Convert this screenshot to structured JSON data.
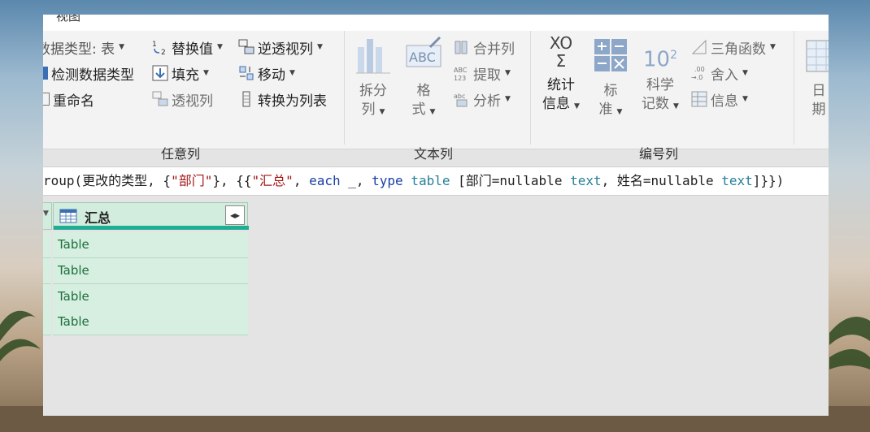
{
  "ribbon": {
    "tab_label": "视图",
    "groups": {
      "any_column": {
        "label": "任意列",
        "data_type": "数据类型: 表",
        "detect_type": "检测数据类型",
        "rename": "重命名",
        "replace_values": "替换值",
        "fill": "填充",
        "pivot": "透视列",
        "unpivot": "逆透视列",
        "move": "移动",
        "to_list": "转换为列表"
      },
      "text_column": {
        "label": "文本列",
        "split_line1": "拆分",
        "split_line2": "列",
        "format_line1": "格",
        "format_line2": "式",
        "merge": "合并列",
        "extract": "提取",
        "parse": "分析"
      },
      "number_column": {
        "label": "编号列",
        "stats_line1": "统计",
        "stats_line2": "信息",
        "standard_line1": "标",
        "standard_line2": "准",
        "sci_line1": "科学",
        "sci_line2": "记数",
        "trig": "三角函数",
        "rounding": "舍入",
        "info": "信息",
        "ten_power": "10",
        "sup": "2",
        "sigma_top": "XO",
        "sigma": "Σ"
      },
      "date_column": {
        "date_line1": "日",
        "date_line2": "期"
      }
    }
  },
  "formula": {
    "p1": "roup(更改的类型, {",
    "s1": "\"部门\"",
    "p2": "}, {{",
    "s2": "\"汇总\"",
    "p3": ", ",
    "k1": "each",
    "p4": " _, ",
    "k2": "type",
    "p5": " ",
    "t1": "table",
    "p6": " [部门=nullable ",
    "t2": "text",
    "p7": ", 姓名=nullable ",
    "t3": "text",
    "p8": "]}})"
  },
  "grid": {
    "column_header": "汇总",
    "rows": [
      "Table",
      "Table",
      "Table",
      "Table"
    ]
  }
}
